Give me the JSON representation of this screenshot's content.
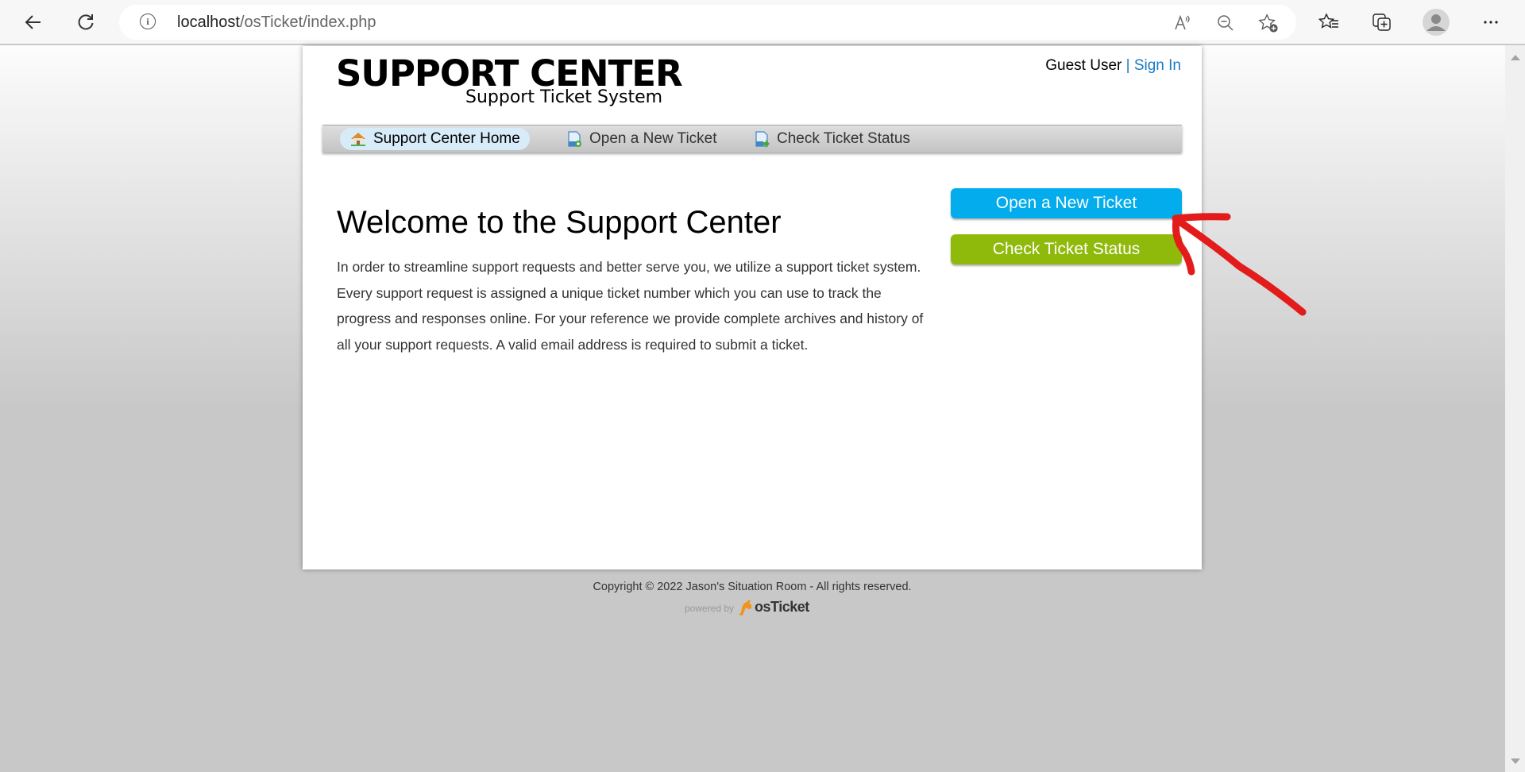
{
  "browser": {
    "url_host": "localhost",
    "url_path": "/osTicket/index.php",
    "icons": [
      "back-icon",
      "refresh-icon",
      "site-info-icon",
      "read-aloud-icon",
      "zoom-out-icon",
      "add-favorite-icon",
      "favorites-icon",
      "collections-icon",
      "profile-icon",
      "more-icon"
    ]
  },
  "header": {
    "logo_title": "SUPPORT CENTER",
    "logo_subtitle": "Support Ticket System",
    "user_label": "Guest User",
    "separator": "|",
    "sign_in": "Sign In"
  },
  "nav": {
    "items": [
      {
        "label": "Support Center Home",
        "icon": "home-icon",
        "active": true
      },
      {
        "label": "Open a New Ticket",
        "icon": "new-ticket-icon",
        "active": false
      },
      {
        "label": "Check Ticket Status",
        "icon": "ticket-status-icon",
        "active": false
      }
    ]
  },
  "main": {
    "title": "Welcome to the Support Center",
    "intro": "In order to streamline support requests and better serve you, we utilize a support ticket system. Every support request is assigned a unique ticket number which you can use to track the progress and responses online. For your reference we provide complete archives and history of all your support requests. A valid email address is required to submit a ticket."
  },
  "sidebar": {
    "open_ticket_label": "Open a New Ticket",
    "check_status_label": "Check Ticket Status",
    "colors": {
      "open_ticket": "#03acec",
      "check_status": "#8fba0b"
    }
  },
  "footer": {
    "copyright": "Copyright © 2022 Jason's Situation Room - All rights reserved.",
    "powered_by": "powered by",
    "brand": "osTicket"
  },
  "annotation": {
    "type": "red-arrow",
    "points_to": "Open a New Ticket button",
    "color": "#e31b1b"
  }
}
